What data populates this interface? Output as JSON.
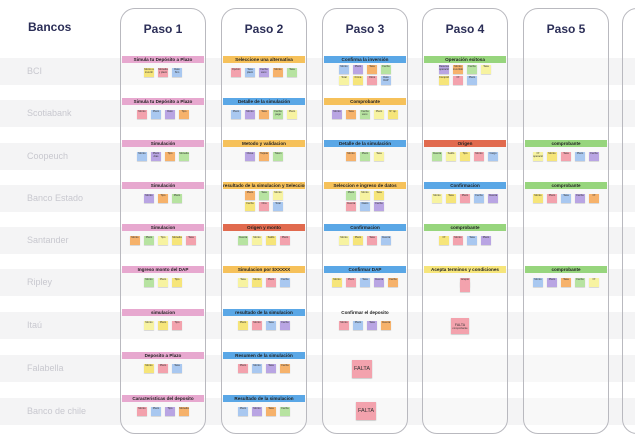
{
  "board": {
    "banks_header": "Bancos",
    "columns": [
      "Paso 1",
      "Paso 2",
      "Paso 3",
      "Paso 4",
      "Paso 5"
    ],
    "banks": [
      "BCI",
      "Scotiabank",
      "Coopeuch",
      "Banco Estado",
      "Santander",
      "Ripley",
      "Itaú",
      "Falabella",
      "Banco de chile"
    ]
  },
  "rows": [
    {
      "bank": "BCI",
      "cells": [
        {
          "title": "Simula tu Depósito a Plazo",
          "color": "#e7a8cf",
          "stickies": [
            "Monto a invertir",
            "Moneda y plazo",
            "Dato Sim"
          ]
        },
        {
          "title": "Seleccione una alternativa",
          "color": "#f6c15a",
          "stickies": [
            "Opción",
            "Tasa plazo",
            "Fecha venc.",
            "Monto",
            "Tasa"
          ]
        },
        {
          "title": "Confirma la inversión",
          "color": "#5aa7e6",
          "stickies": [
            "Monto",
            "Plazo",
            "Tasa",
            "Fecha",
            "Total",
            "Firma",
            "Otros",
            "Dato DAP"
          ]
        },
        {
          "title": "Operación exitosa",
          "color": "#97d57d",
          "stickies": [
            "Resumen operación",
            "Monto invertido",
            "Fecha",
            "Tasa",
            "Comprobante",
            "Nº",
            "Plazo"
          ]
        },
        null
      ]
    },
    {
      "bank": "Scotiabank",
      "cells": [
        {
          "title": "Simula tu Depósito a Plazo",
          "color": "#e7a8cf",
          "stickies": [
            "Monto",
            "Plazo",
            "Dato",
            "Tipo"
          ]
        },
        {
          "title": "Detalle de la simulación",
          "color": "#5aa7e6",
          "stickies": [
            "Plazo",
            "Monto",
            "Tasa",
            "Fecha pago",
            "Plazo"
          ]
        },
        {
          "title": "Comprobante",
          "color": "#f6c15a",
          "stickies": [
            "Monto",
            "Tasa",
            "Fecha venc.",
            "Plazo",
            "Nº op."
          ]
        },
        null,
        null
      ]
    },
    {
      "bank": "Coopeuch",
      "cells": [
        {
          "title": "Simulación",
          "color": "#e7a8cf",
          "stickies": [
            "Monto",
            "Plazo días",
            "Tipo",
            "Moneda"
          ]
        },
        {
          "title": "Metodo y validacion",
          "color": "#f6c15a",
          "stickies": [
            "Clave",
            "Tarjeta",
            "Token"
          ]
        },
        {
          "title": "Detalle de la simulación",
          "color": "#5aa7e6",
          "stickies": [
            "Monto",
            "Plazo",
            "Tasa"
          ]
        },
        {
          "title": "Origen",
          "color": "#e16a4e",
          "stickies": [
            "Cuenta",
            "Saldo",
            "Tipo",
            "Monto",
            "Cargo"
          ]
        },
        {
          "title": "comprobante",
          "color": "#97d57d",
          "stickies": [
            "Nº operación",
            "Monto",
            "Tasa",
            "Plazo",
            "Fecha"
          ]
        }
      ]
    },
    {
      "bank": "Banco Estado",
      "cells": [
        {
          "title": "Simulación",
          "color": "#e7a8cf",
          "stickies": [
            "Monto",
            "Tipo",
            "Plazo"
          ]
        },
        {
          "title": "resultado de la simulacion y Selecciona otra alternativa",
          "color": "#f6c15a",
          "stickies": [
            "Plazo",
            "Tasa",
            "Monto",
            "Fecha",
            "Otra",
            "Total"
          ]
        },
        {
          "title": "Seleccion e ingreso de datos",
          "color": "#f6c15a",
          "stickies": [
            "Plazo",
            "Monto",
            "Tasa",
            "Cuenta",
            "Datos",
            "Fecha"
          ]
        },
        {
          "title": "Confirmacion",
          "color": "#5aa7e6",
          "stickies": [
            "Monto",
            "Tasa",
            "Plazo",
            "Fecha",
            "Cuenta"
          ]
        },
        {
          "title": "comprobante",
          "color": "#97d57d",
          "stickies": [
            "Monto",
            "Plazo",
            "Tasa",
            "Fecha",
            "Nº"
          ]
        }
      ]
    },
    {
      "bank": "Santander",
      "cells": [
        {
          "title": "Simulacion",
          "color": "#e7a8cf",
          "stickies": [
            "Monto",
            "Plazo",
            "Tipo",
            "Moneda",
            "Tasa"
          ]
        },
        {
          "title": "Origen y monto",
          "color": "#e16a4e",
          "stickies": [
            "Cuenta",
            "Monto",
            "Saldo",
            "Plazo"
          ]
        },
        {
          "title": "Confirmacion",
          "color": "#5aa7e6",
          "stickies": [
            "Monto",
            "Plazo",
            "Tasa",
            "Cuenta"
          ]
        },
        {
          "title": "comprobante",
          "color": "#97d57d",
          "stickies": [
            "Nº",
            "Monto",
            "Tasa",
            "Plazo"
          ]
        },
        null
      ]
    },
    {
      "bank": "Ripley",
      "cells": [
        {
          "title": "Ingreso monto del DAP",
          "color": "#e7a8cf",
          "stickies": [
            "Monto",
            "Plazo",
            "Tipo"
          ]
        },
        {
          "title": "Simulacion por $XXXXX",
          "color": "#f6c15a",
          "stickies": [
            "Tasa",
            "Monto",
            "Plazo",
            "Fecha"
          ]
        },
        {
          "title": "Confirmar DAP",
          "color": "#5aa7e6",
          "stickies": [
            "Monto",
            "Plazo",
            "Tasa",
            "Cuenta",
            "Fecha"
          ]
        },
        {
          "title": "Acepta terminos y condiciones",
          "color": "#f6e57a",
          "stickies": [
            "Acepto"
          ]
        },
        {
          "title": "comprobante",
          "color": "#97d57d",
          "stickies": [
            "Monto",
            "Plazo",
            "Tasa",
            "Fecha",
            "Nº"
          ]
        }
      ]
    },
    {
      "bank": "Itaú",
      "cells": [
        {
          "title": "simulacion",
          "color": "#e7a8cf",
          "stickies": [
            "Monto",
            "Plazo",
            "Tipo"
          ]
        },
        {
          "title": "resultado de la simulacion",
          "color": "#5aa7e6",
          "stickies": [
            "Plazo",
            "Monto",
            "Tasa",
            "Fecha"
          ]
        },
        {
          "title": "Confirmar el deposito",
          "color": "#ffffff",
          "stickies": [
            "Monto",
            "Plazo",
            "Tasa",
            "Cuenta"
          ]
        },
        null,
        null
      ]
    },
    {
      "bank": "Falabella",
      "cells": [
        {
          "title": "Deposito a Plazo",
          "color": "#e7a8cf",
          "stickies": [
            "Monto",
            "Plazo",
            "Tasa"
          ]
        },
        {
          "title": "Resumen de la simulación",
          "color": "#5aa7e6",
          "stickies": [
            "Plazo",
            "Monto",
            "Tasa",
            "Fecha"
          ]
        },
        null,
        null,
        null
      ]
    },
    {
      "bank": "Banco de chile",
      "cells": [
        {
          "title": "Caracteristicas del deposito",
          "color": "#e7a8cf",
          "stickies": [
            "Monto",
            "Plazo",
            "Tipo",
            "Moneda"
          ]
        },
        {
          "title": "Resultado de la simulacion",
          "color": "#5aa7e6",
          "stickies": [
            "Plazo",
            "Monto",
            "Tasa",
            "Fecha"
          ]
        },
        null,
        null,
        null
      ]
    }
  ],
  "missing_notes": {
    "label": "FALTA",
    "note_sub": "comprobante"
  },
  "sticky_palette": [
    "#f6e57a",
    "#f3a2ad",
    "#a9c8f0",
    "#b9a5e3",
    "#f6b26b",
    "#b7e3a1",
    "#f7f3a1"
  ]
}
